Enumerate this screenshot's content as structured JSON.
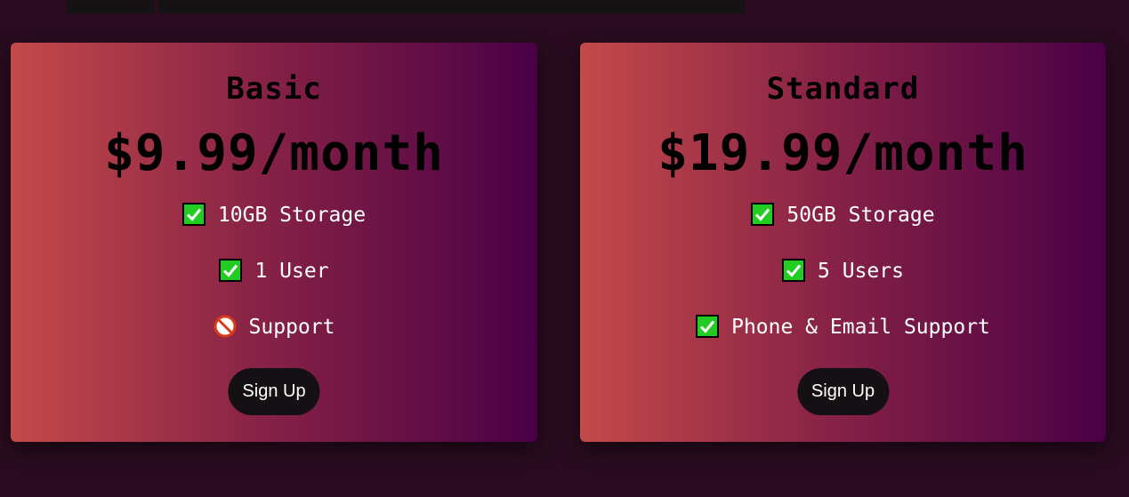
{
  "colors": {
    "background": "#2a0c20",
    "gradient_start": "#c44a4a",
    "gradient_end": "#4a0046",
    "button_bg": "#141013",
    "check_green": "#22cc22"
  },
  "plans": [
    {
      "name": "Basic",
      "price": "$9.99/month",
      "features": [
        {
          "icon": "check-icon",
          "text": "10GB Storage"
        },
        {
          "icon": "check-icon",
          "text": "1 User"
        },
        {
          "icon": "prohibited-icon",
          "text": "Support"
        }
      ],
      "button": "Sign Up"
    },
    {
      "name": "Standard",
      "price": "$19.99/month",
      "features": [
        {
          "icon": "check-icon",
          "text": "50GB Storage"
        },
        {
          "icon": "check-icon",
          "text": "5 Users"
        },
        {
          "icon": "check-icon",
          "text": "Phone & Email Support"
        }
      ],
      "button": "Sign Up"
    }
  ]
}
